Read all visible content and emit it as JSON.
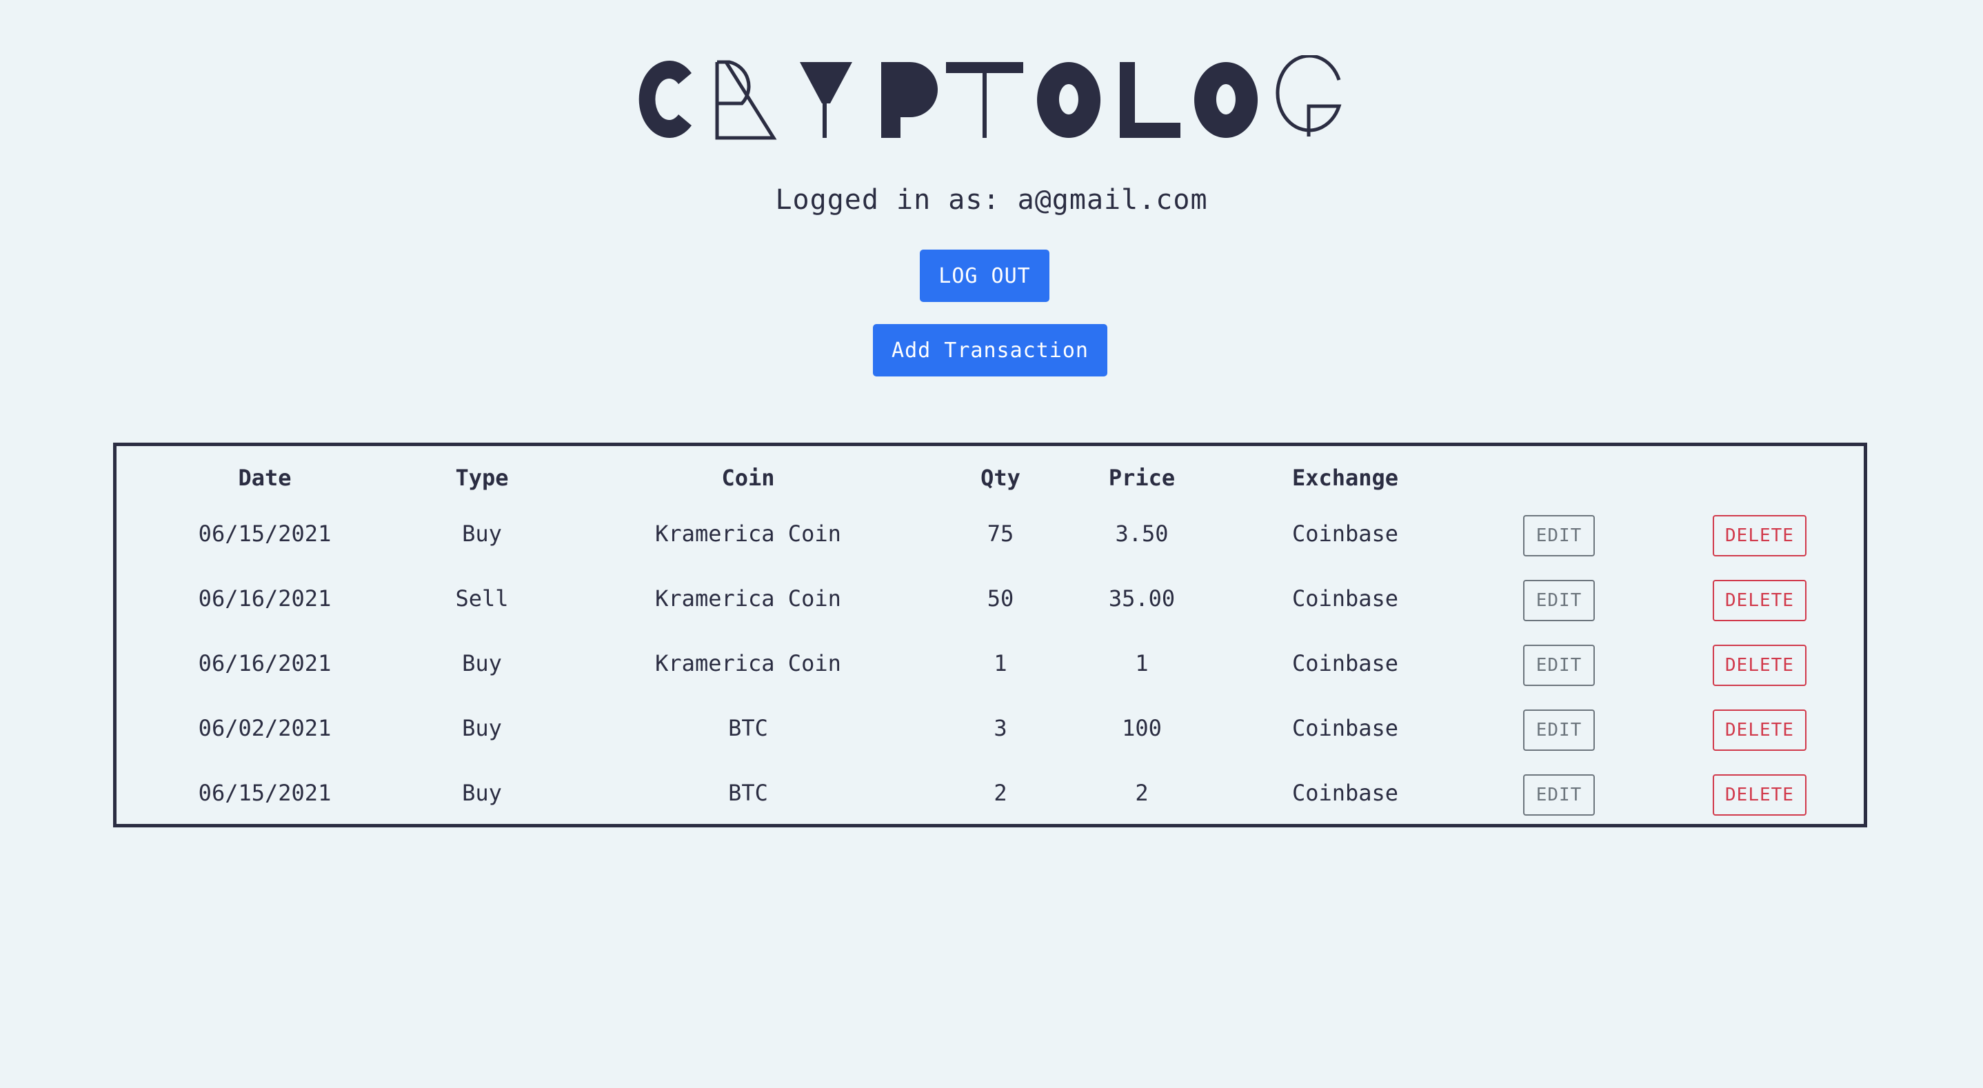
{
  "app": {
    "logo_text": "CRYPTOLOG"
  },
  "user": {
    "logged_in_label": "Logged in as: a@gmail.com"
  },
  "actions": {
    "logout_label": "LOG OUT",
    "add_transaction_label": "Add Transaction"
  },
  "table": {
    "headers": {
      "date": "Date",
      "type": "Type",
      "coin": "Coin",
      "qty": "Qty",
      "price": "Price",
      "exchange": "Exchange"
    },
    "edit_label": "EDIT",
    "delete_label": "DELETE",
    "rows": [
      {
        "date": "06/15/2021",
        "type": "Buy",
        "coin": "Kramerica Coin",
        "qty": "75",
        "price": "3.50",
        "exchange": "Coinbase"
      },
      {
        "date": "06/16/2021",
        "type": "Sell",
        "coin": "Kramerica Coin",
        "qty": "50",
        "price": "35.00",
        "exchange": "Coinbase"
      },
      {
        "date": "06/16/2021",
        "type": "Buy",
        "coin": "Kramerica Coin",
        "qty": "1",
        "price": "1",
        "exchange": "Coinbase"
      },
      {
        "date": "06/02/2021",
        "type": "Buy",
        "coin": "BTC",
        "qty": "3",
        "price": "100",
        "exchange": "Coinbase"
      },
      {
        "date": "06/15/2021",
        "type": "Buy",
        "coin": "BTC",
        "qty": "2",
        "price": "2",
        "exchange": "Coinbase"
      }
    ]
  },
  "colors": {
    "background": "#edf4f7",
    "text": "#2b2d42",
    "primary": "#2c72f2",
    "edit": "#6c757d",
    "delete": "#d1394b"
  }
}
